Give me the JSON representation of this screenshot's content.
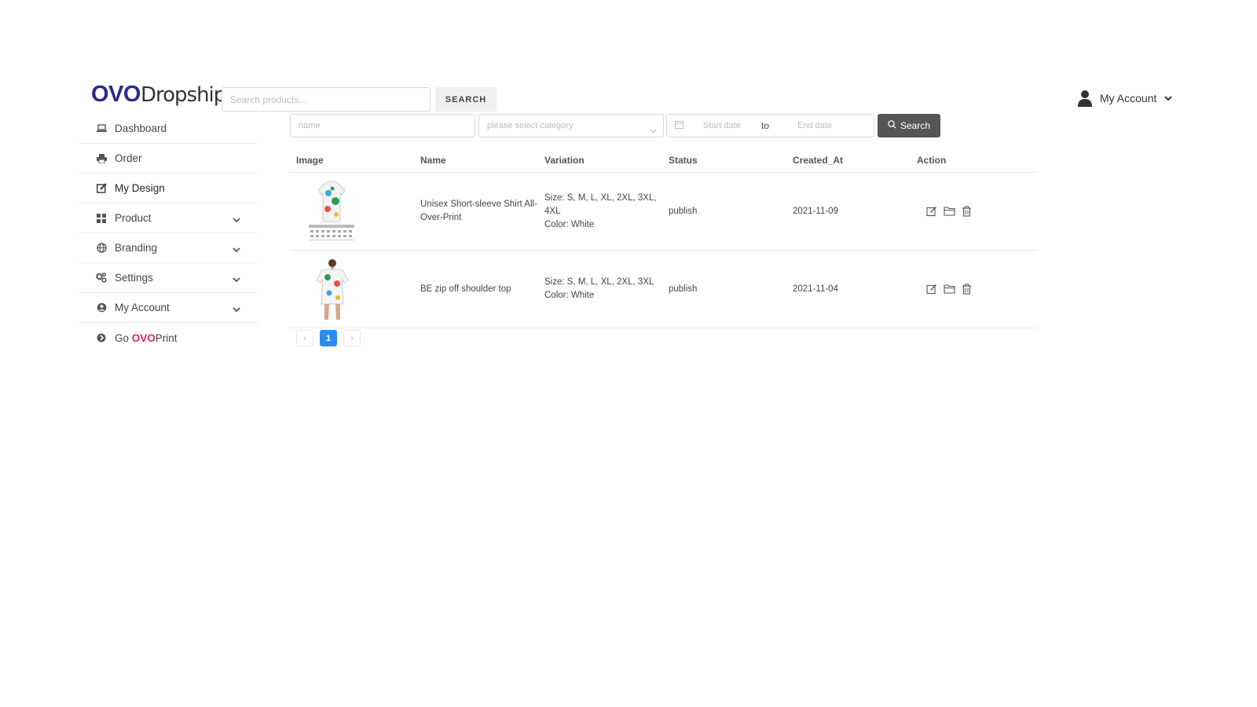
{
  "header": {
    "logo_part1": "OVO",
    "logo_part2": "Dropship",
    "search_placeholder": "Search products...",
    "search_button": "SEARCH",
    "account_label": "My Account"
  },
  "sidebar": {
    "items": [
      {
        "label": "Dashboard",
        "icon": "laptop-icon"
      },
      {
        "label": "Order",
        "icon": "printer-icon"
      },
      {
        "label": "My Design",
        "icon": "edit-icon"
      },
      {
        "label": "Product",
        "icon": "grid-icon"
      },
      {
        "label": "Branding",
        "icon": "globe-icon"
      },
      {
        "label": "Settings",
        "icon": "gears-icon"
      },
      {
        "label": "My Account",
        "icon": "user-circle-icon"
      }
    ],
    "go_prefix": "Go ",
    "go_brand": "OVO",
    "go_suffix": "Print"
  },
  "filters": {
    "name_placeholder": "name",
    "category_placeholder": "please select category",
    "start_placeholder": "Start date",
    "to_label": "to",
    "end_placeholder": "End date",
    "search_button": "Search"
  },
  "table": {
    "headers": [
      "Image",
      "Name",
      "Variation",
      "Status",
      "Created_At",
      "Action"
    ],
    "rows": [
      {
        "name": "Unisex Short-sleeve Shirt All-Over-Print",
        "variation_size": "Size: S, M, L, XL, 2XL, 3XL, 4XL",
        "variation_color": "Color: White",
        "status": "publish",
        "created_at": "2021-11-09"
      },
      {
        "name": "BE zip off shoulder top",
        "variation_size": "Size: S, M, L, XL, 2XL, 3XL",
        "variation_color": "Color: White",
        "status": "publish",
        "created_at": "2021-11-04"
      }
    ]
  },
  "pagination": {
    "prev": "‹",
    "current": "1",
    "next": "›"
  },
  "colors": {
    "brand": "#2b2a8a",
    "go_ovo": "#e0245e",
    "page_active": "#2d8cf0",
    "search_button": "#555555"
  }
}
